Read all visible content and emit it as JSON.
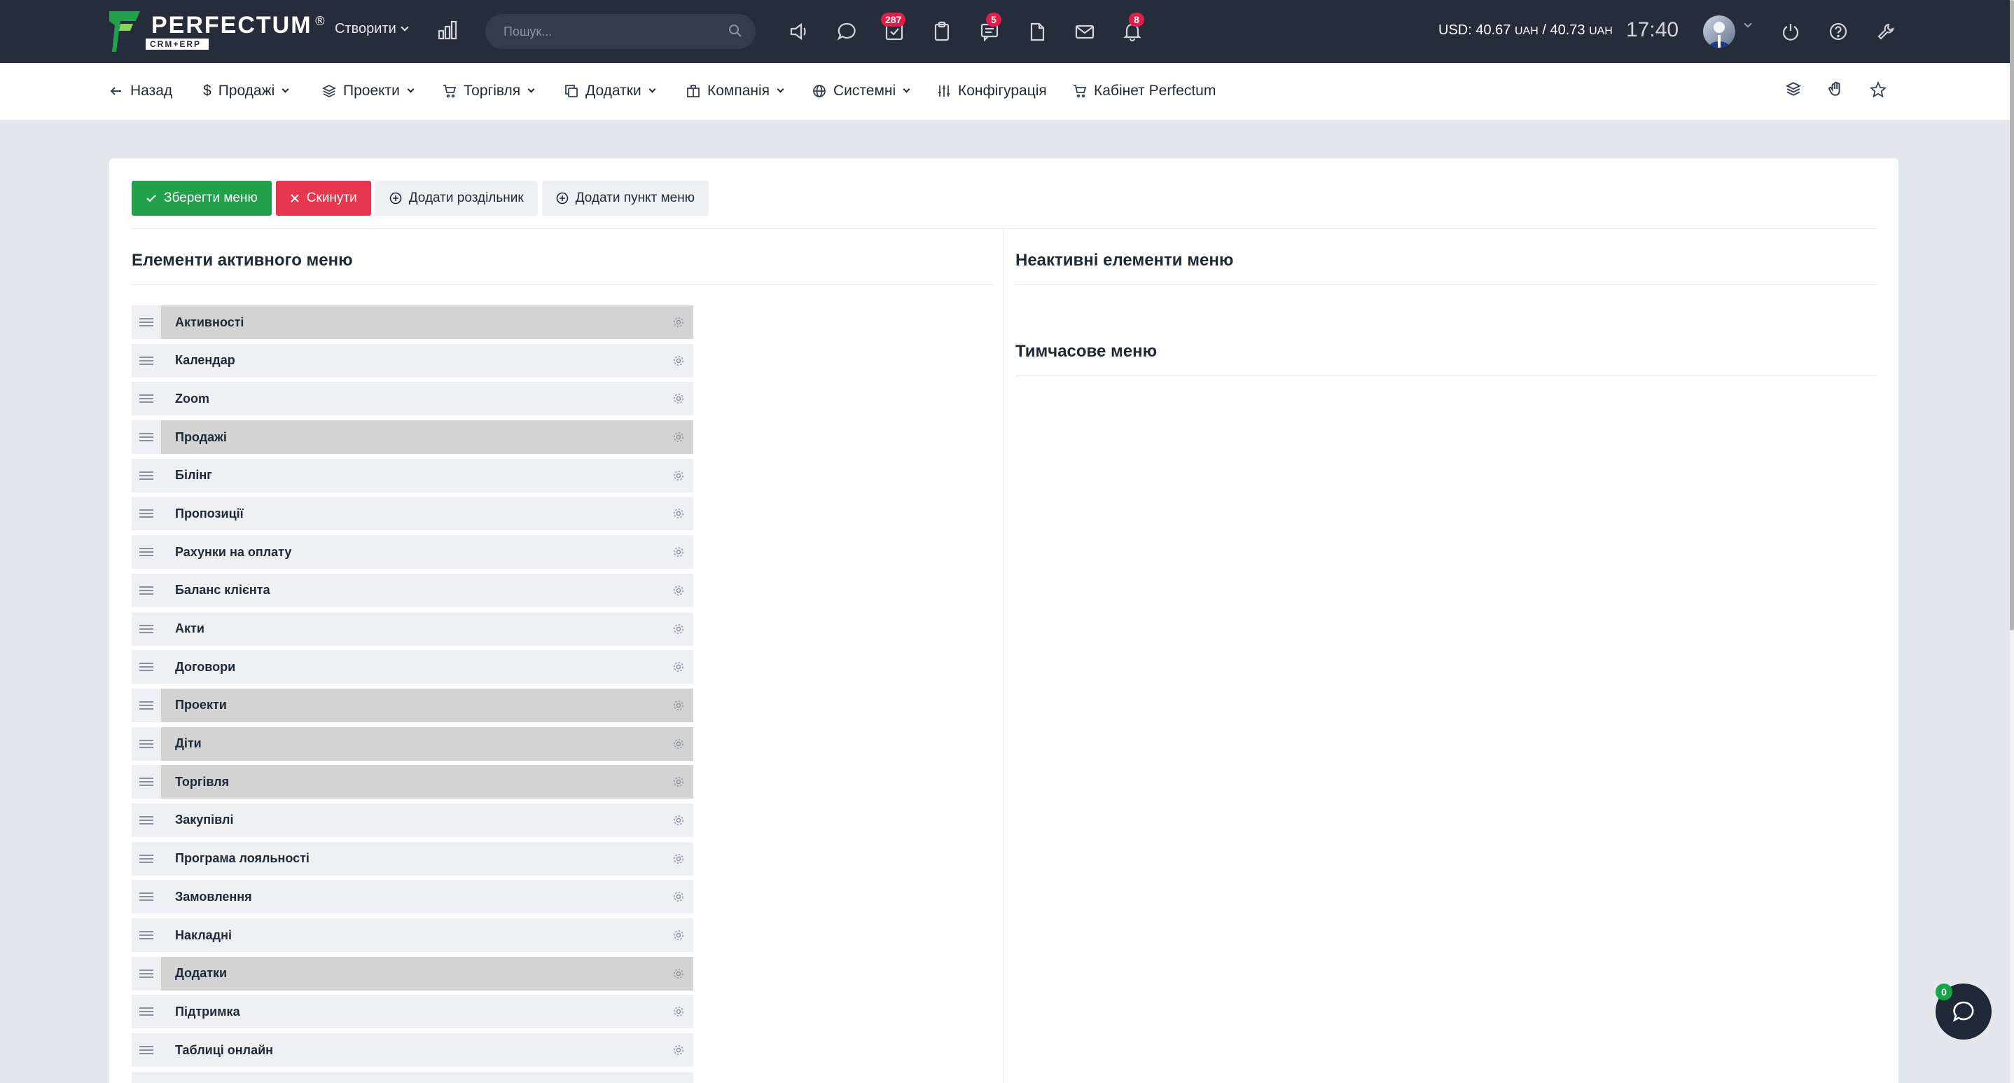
{
  "brand": {
    "name": "PERFECTUM",
    "sub": "CRM+ERP",
    "reg": "®"
  },
  "topbar": {
    "create_label": "Створити",
    "search_placeholder": "Пошук...",
    "badges": {
      "tasks": "287",
      "chat": "5",
      "notifications": "8"
    },
    "currency_usd_label": "USD:",
    "currency_buy": "40.67",
    "currency_sell": "40.73",
    "currency_unit": "UAH",
    "currency_sep": "/",
    "time": "17:40"
  },
  "nav": {
    "back": "Назад",
    "sales": "Продажі",
    "projects": "Проекти",
    "trade": "Торгівля",
    "addons": "Додатки",
    "company": "Компанія",
    "system": "Системні",
    "config": "Конфігурація",
    "cabinet": "Кабінет Perfectum"
  },
  "actions": {
    "save": "Зберегти меню",
    "reset": "Скинути",
    "add_divider": "Додати роздільник",
    "add_item": "Додати пункт меню"
  },
  "active_section": {
    "title": "Елементи активного меню",
    "items": [
      {
        "label": "Активності",
        "parent": true
      },
      {
        "label": "Календар",
        "parent": false
      },
      {
        "label": "Zoom",
        "parent": false
      },
      {
        "label": "Продажі",
        "parent": true
      },
      {
        "label": "Білінг",
        "parent": false
      },
      {
        "label": "Пропозиції",
        "parent": false
      },
      {
        "label": "Рахунки на оплату",
        "parent": false
      },
      {
        "label": "Баланс клієнта",
        "parent": false
      },
      {
        "label": "Акти",
        "parent": false
      },
      {
        "label": "Договори",
        "parent": false
      },
      {
        "label": "Проекти",
        "parent": true
      },
      {
        "label": "Діти",
        "parent": true
      },
      {
        "label": "Торгівля",
        "parent": true
      },
      {
        "label": "Закупівлі",
        "parent": false
      },
      {
        "label": "Програма лояльності",
        "parent": false
      },
      {
        "label": "Замовлення",
        "parent": false
      },
      {
        "label": "Накладні",
        "parent": false
      },
      {
        "label": "Додатки",
        "parent": true
      },
      {
        "label": "Підтримка",
        "parent": false
      },
      {
        "label": "Таблиці онлайн",
        "parent": false
      },
      {
        "label": "",
        "parent": false
      }
    ]
  },
  "inactive_section": {
    "title": "Неактивні елементи меню"
  },
  "temp_section": {
    "title": "Тимчасове меню"
  },
  "chat": {
    "badge": "0"
  },
  "colors": {
    "topbar": "#252c3a",
    "save": "#22a04b",
    "reset": "#e5374f",
    "badge": "#e11d48"
  }
}
